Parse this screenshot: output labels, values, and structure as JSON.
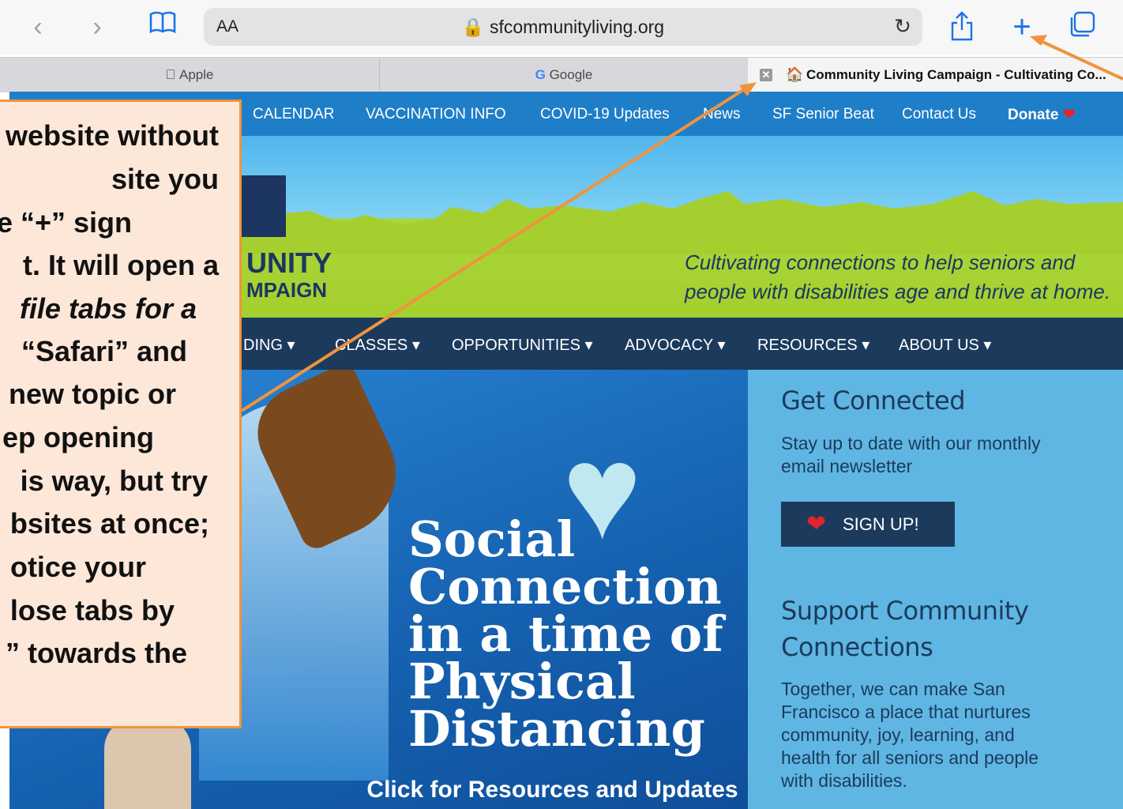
{
  "browser": {
    "url_aa": "AA",
    "url": "sfcommunityliving.org",
    "tabs": [
      {
        "label": "Apple",
        "icon": "apple-icon"
      },
      {
        "label": "Google",
        "icon": "google-icon"
      },
      {
        "label": "Community Living Campaign - Cultivating Co...",
        "icon": "site-favicon",
        "active": true
      }
    ]
  },
  "site": {
    "top_nav": [
      "CALENDAR",
      "VACCINATION INFO",
      "COVID-19 Updates",
      "News",
      "SF Senior Beat",
      "Contact Us",
      "Donate"
    ],
    "logo_line1": "UNITY",
    "logo_line2": "MPAIGN",
    "tagline_line1": "Cultivating connections to help seniors and",
    "tagline_line2": "people with disabilities age and thrive at home.",
    "main_nav": [
      "DING",
      "CLASSES",
      "OPPORTUNITIES",
      "ADVOCACY",
      "RESOURCES",
      "ABOUT US"
    ],
    "banner": {
      "title_lines": [
        "Social",
        "Connection",
        "in a time of",
        "Physical",
        "Distancing"
      ],
      "cta": "Click for Resources and Updates"
    },
    "sidebar": {
      "heading1": "Get Connected",
      "text1_line1": "Stay up to date with our monthly",
      "text1_line2": "email newsletter",
      "signup": "SIGN UP!",
      "heading2_line1": "Support Community",
      "heading2_line2": "Connections",
      "text2_lines": [
        "Together, we can make San",
        "Francisco a place that nurtures",
        "community, joy, learning, and",
        "health for all seniors and people",
        "with disabilities."
      ]
    }
  },
  "callout": {
    "lines": [
      "website without",
      "site you",
      "e “+” sign",
      "t. It will open a",
      "file tabs for a",
      "“Safari” and",
      "new topic or",
      "ep opening",
      "is way, but try",
      "bsites at once;",
      "otice your",
      "lose tabs by",
      "” towards the"
    ]
  },
  "colors": {
    "accent": "#1a73e8",
    "callout_border": "#f0943c",
    "callout_bg": "#fde7d9",
    "site_dark": "#1c3a5c",
    "site_blue": "#1f7ec8"
  }
}
